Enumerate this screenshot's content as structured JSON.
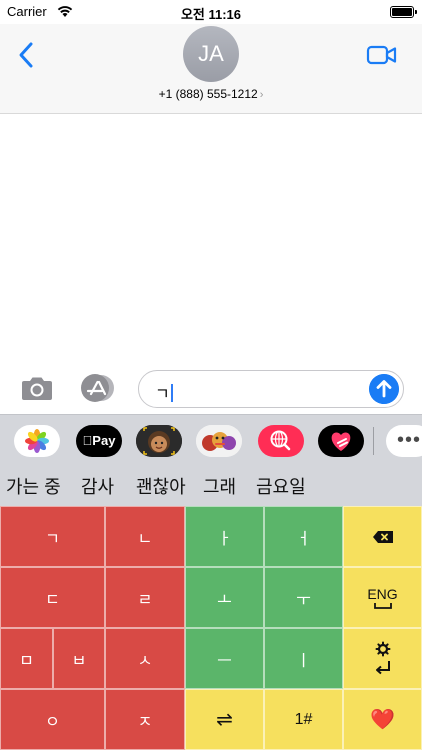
{
  "status_bar": {
    "carrier": "Carrier",
    "time": "오전 11:16"
  },
  "header": {
    "avatar_initials": "JA",
    "contact": "+1 (888) 555-1212",
    "chevron": "›"
  },
  "input": {
    "text": "ㄱ"
  },
  "app_strip": {
    "apps": [
      "photos-icon",
      "apple-pay-icon",
      "memoji-icon",
      "stickers-icon",
      "search-icon",
      "heart-icon"
    ],
    "apple_pay_label": "Pay",
    "more_label": "•••"
  },
  "suggestions": [
    "가는 중",
    "감사",
    "괜찮아",
    "그래",
    "금요일"
  ],
  "keyboard": {
    "k_giyeok": "ㄱ",
    "k_nieun": "ㄴ",
    "k_a": "ㅏ",
    "k_eo": "ㅓ",
    "k_digeut": "ㄷ",
    "k_rieul": "ㄹ",
    "k_o": "ㅗ",
    "k_u": "ㅜ",
    "k_mieum": "ㅁ",
    "k_bieup": "ㅂ",
    "k_siot": "ㅅ",
    "k_eu": "ㅡ",
    "k_i": "ㅣ",
    "k_ieung": "ㅇ",
    "k_jieut": "ㅈ",
    "k_switch": "⇌",
    "k_numbers": "1#",
    "k_heart": "❤️",
    "k_eng": "ENG"
  },
  "colors": {
    "red_keys": "#d84a45",
    "green_keys": "#5bb56a",
    "yellow_keys": "#f6e05e",
    "accent": "#1a7cf5"
  }
}
